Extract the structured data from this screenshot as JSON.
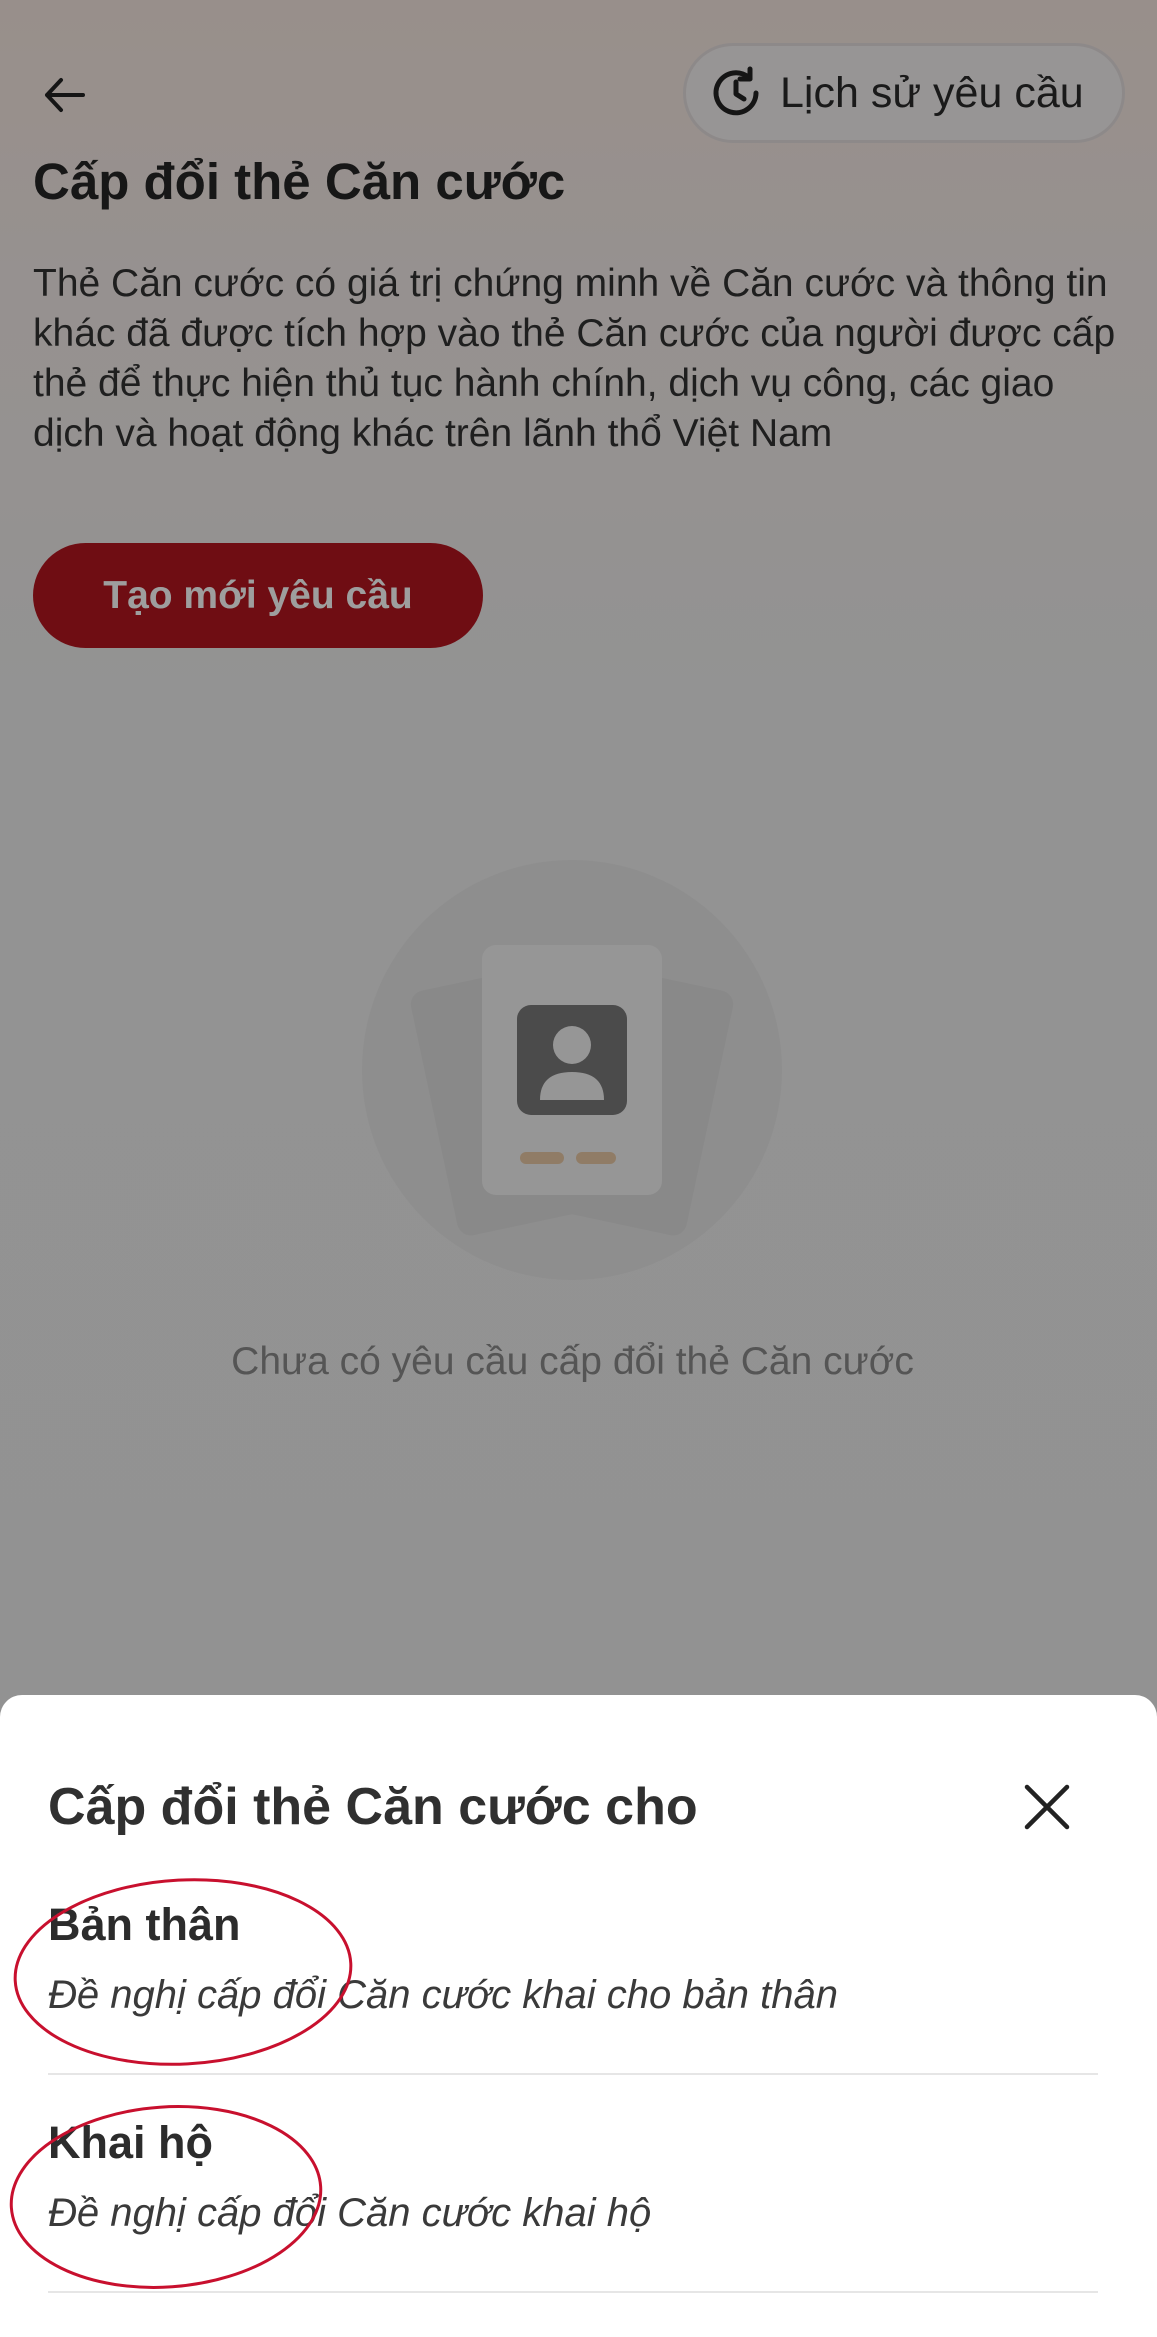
{
  "header": {
    "back_icon": "arrow-left-icon",
    "history_icon": "history-clock-icon",
    "history_label": "Lịch sử yêu cầu"
  },
  "page": {
    "title": "Cấp đổi thẻ Căn cước",
    "description": "Thẻ Căn cước có giá trị chứng minh về Căn cước và thông tin khác đã được tích hợp vào thẻ Căn cước của người được cấp thẻ để thực hiện thủ tục hành chính, dịch vụ công, các giao dịch và hoạt động khác trên lãnh thổ Việt Nam",
    "create_button_label": "Tạo mới yêu cầu",
    "empty_illustration_icon": "id-card-icon",
    "empty_text": "Chưa có yêu cầu cấp đổi thẻ Căn cước"
  },
  "sheet": {
    "title": "Cấp đổi thẻ Căn cước cho",
    "close_icon": "close-icon",
    "options": [
      {
        "label": "Bản thân",
        "description": "Đề nghị cấp đổi Căn cước khai cho bản thân"
      },
      {
        "label": "Khai hộ",
        "description": "Đề nghị cấp đổi Căn cước khai hộ"
      }
    ]
  },
  "colors": {
    "primary_red": "#b4161f",
    "annotation_red": "#c8102e",
    "overlay": "rgba(0,0,0,0.38)"
  }
}
